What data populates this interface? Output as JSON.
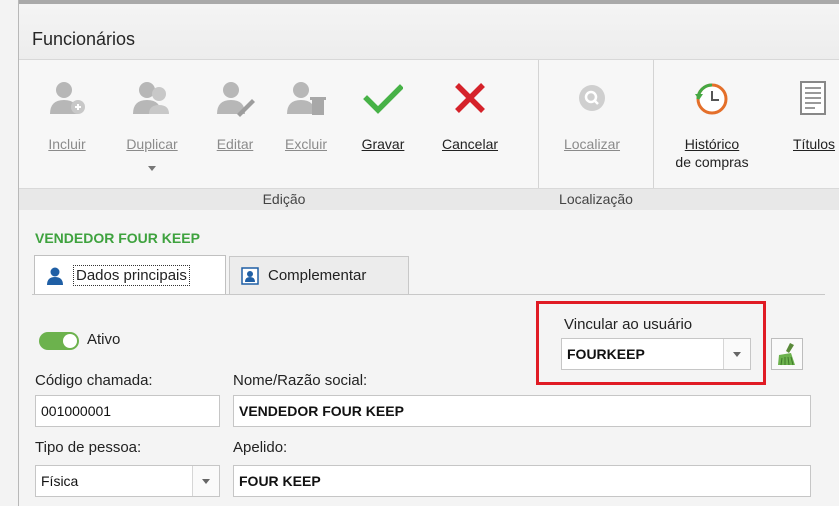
{
  "window": {
    "title": "Funcionários"
  },
  "ribbon": {
    "buttons": {
      "incluir": "Incluir",
      "duplicar": "Duplicar",
      "editar": "Editar",
      "excluir": "Excluir",
      "gravar": "Gravar",
      "cancelar": "Cancelar",
      "localizar": "Localizar",
      "historico_line1": "Histórico",
      "historico_line2": "de compras",
      "titulos": "Títulos"
    },
    "groups": {
      "edicao": "Edição",
      "localizacao": "Localização"
    },
    "colors": {
      "green_check": "#47b247",
      "red_x": "#d5222a",
      "disabled": "#b7b7b7"
    }
  },
  "record": {
    "title": "VENDEDOR FOUR KEEP",
    "title_color": "#3ea23e"
  },
  "tabs": [
    {
      "label": "Dados principais"
    },
    {
      "label": "Complementar"
    }
  ],
  "form": {
    "ativo_label": "Ativo",
    "ativo_on": true,
    "vincular_label": "Vincular ao usuário",
    "vincular_value": "FOURKEEP",
    "codigo_label": "Código chamada:",
    "codigo_value": "001000001",
    "nome_label": "Nome/Razão social:",
    "nome_value": "VENDEDOR FOUR KEEP",
    "tipo_label": "Tipo de pessoa:",
    "tipo_value": "Física",
    "apelido_label": "Apelido:",
    "apelido_value": "FOUR KEEP"
  }
}
